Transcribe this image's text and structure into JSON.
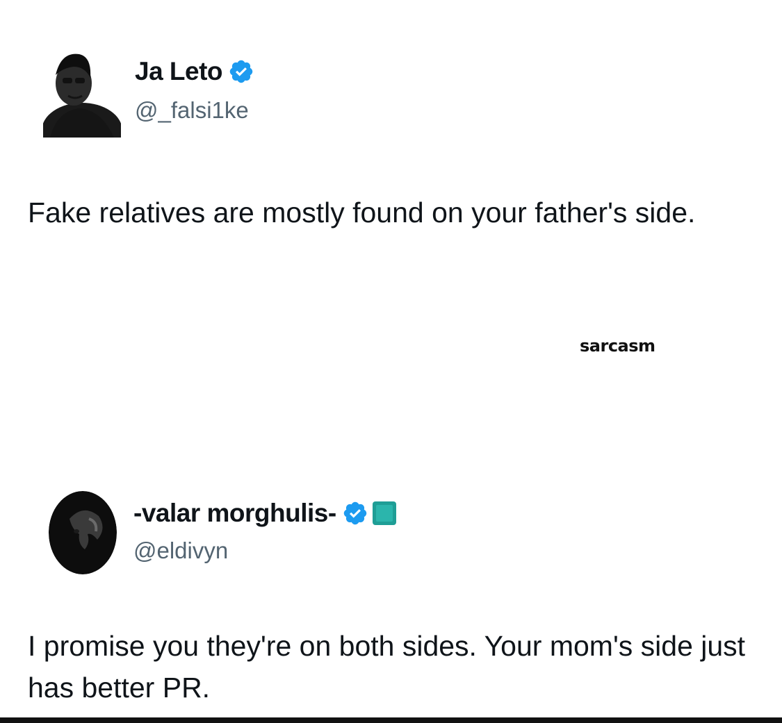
{
  "tweets": [
    {
      "display_name": "Ja Leto",
      "handle": "@_falsi1ke",
      "verified": true,
      "text": "Fake relatives are mostly found on your father's side."
    },
    {
      "display_name": "-valar morghulis-",
      "handle": "@eldivyn",
      "verified": true,
      "affiliation_badge": true,
      "text": "I promise you they're on both sides. Your mom's side just has better PR."
    }
  ],
  "watermark": "sarcasm",
  "colors": {
    "verified": "#1d9bf0",
    "affiliation_badge": "#1f9e96",
    "handle": "#536471",
    "text": "#0f1419"
  },
  "icons": {
    "verified": "verified-badge-icon",
    "affiliation": "affiliation-badge-icon"
  }
}
